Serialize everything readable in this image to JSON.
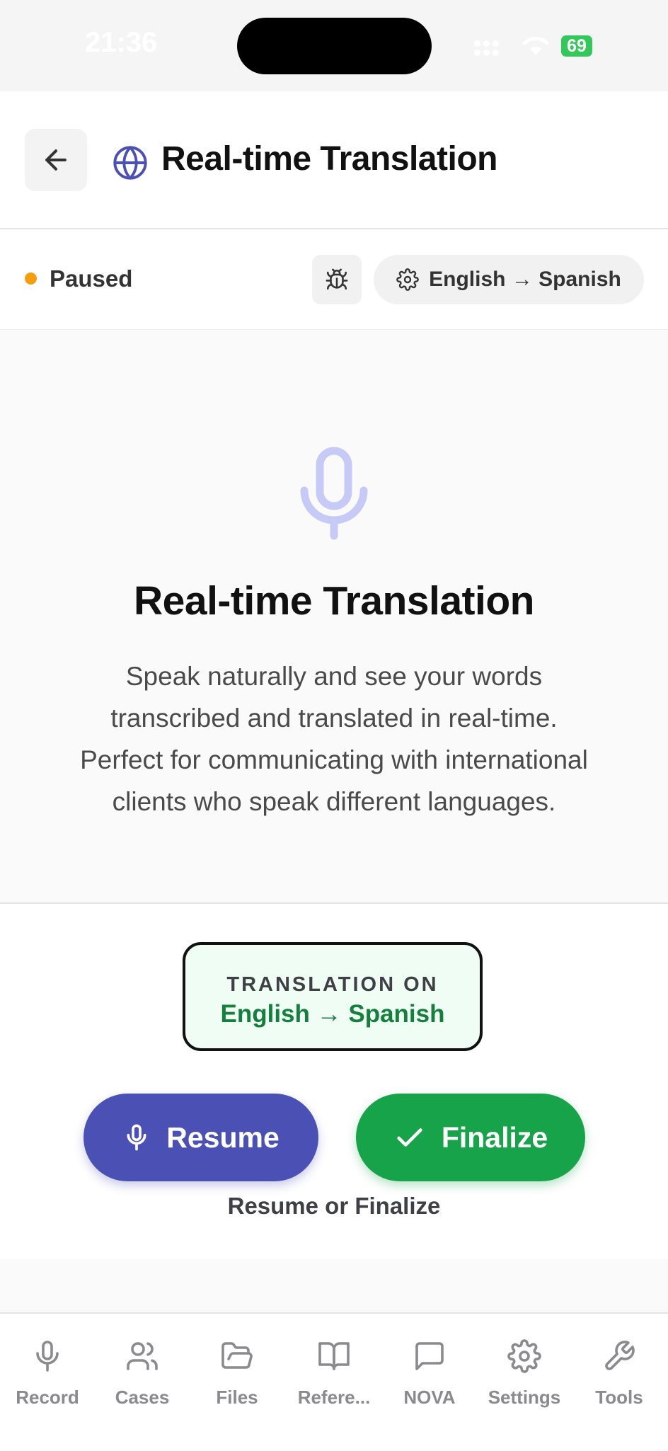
{
  "status_bar": {
    "time": "21:36",
    "battery": "69"
  },
  "header": {
    "title": "Real-time Translation",
    "back_icon": "arrow-left-icon",
    "title_icon": "globe-icon"
  },
  "session": {
    "status": "Paused",
    "status_color": "#f59e0b",
    "language_pair": "English → Spanish"
  },
  "hero": {
    "title": "Real-time Translation",
    "description": "Speak naturally and see your words transcribed and translated in real-time. Perfect for communicating with international clients who speak different languages."
  },
  "translation_badge": {
    "heading": "TRANSLATION ON",
    "languages": "English → Spanish"
  },
  "actions": {
    "resume_label": "Resume",
    "finalize_label": "Finalize",
    "hint": "Resume or Finalize"
  },
  "colors": {
    "accent": "#4b50b5",
    "success": "#16a34a",
    "badge_text": "#15803d"
  },
  "tabs": [
    {
      "label": "Record",
      "icon": "mic-icon"
    },
    {
      "label": "Cases",
      "icon": "users-icon"
    },
    {
      "label": "Files",
      "icon": "folder-open-icon"
    },
    {
      "label": "Refere...",
      "icon": "book-open-icon"
    },
    {
      "label": "NOVA",
      "icon": "message-square-icon"
    },
    {
      "label": "Settings",
      "icon": "gear-icon"
    },
    {
      "label": "Tools",
      "icon": "wrench-icon"
    }
  ]
}
